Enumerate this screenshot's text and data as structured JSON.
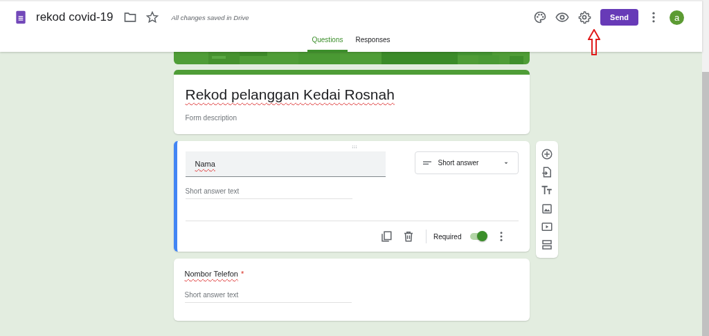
{
  "header": {
    "title": "rekod covid-19",
    "save_status": "All changes saved in Drive",
    "send_button": "Send",
    "avatar": "a"
  },
  "tabs": [
    {
      "label": "Questions",
      "selected": true
    },
    {
      "label": "Responses",
      "selected": false
    }
  ],
  "form": {
    "title": "Rekod pelanggan Kedai Rosnah",
    "description_placeholder": "Form description"
  },
  "questions": [
    {
      "kind": "editing",
      "title": "Nama",
      "answer_placeholder": "Short answer text",
      "type_label": "Short answer",
      "required_label": "Required",
      "required": true,
      "selected": true
    },
    {
      "kind": "preview",
      "title": "Nombor Telefon",
      "required": true,
      "required_mark": "*",
      "answer_placeholder": "Short answer text",
      "selected": false
    }
  ]
}
